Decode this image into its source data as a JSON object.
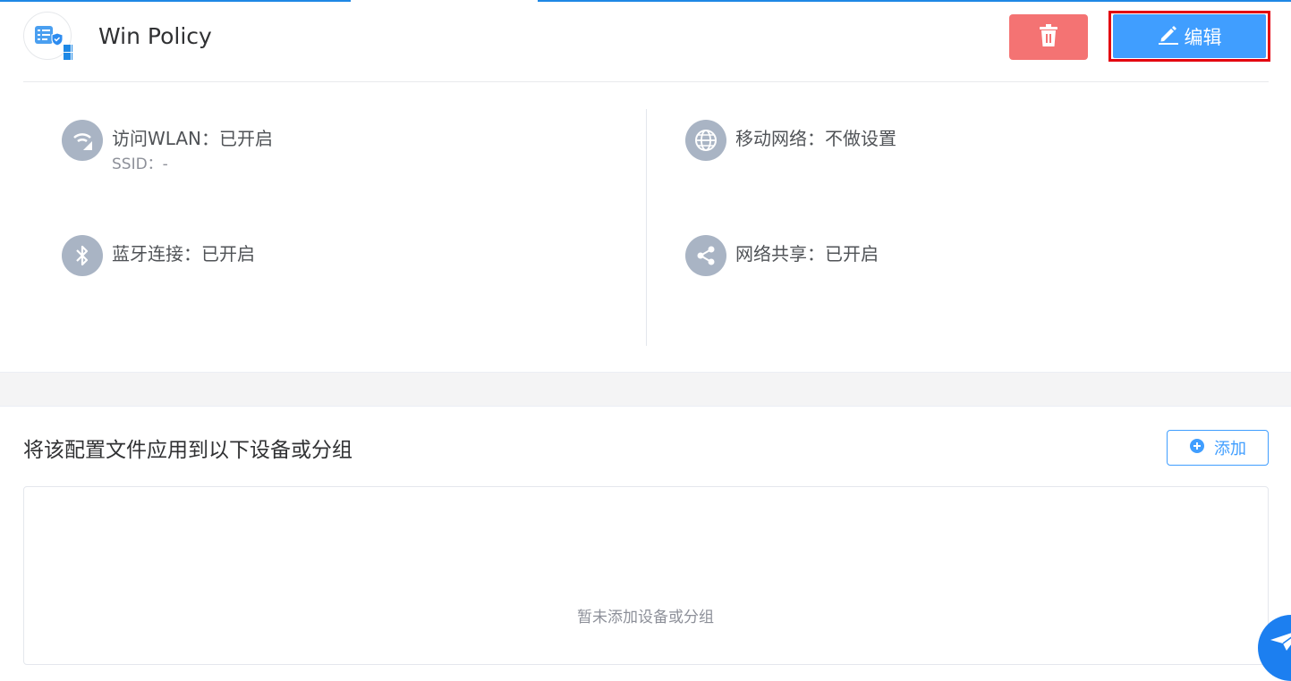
{
  "header": {
    "title": "Win Policy",
    "logo_icon": "policy-windows-icon",
    "delete_icon": "trash-icon",
    "edit_icon": "pencil-icon",
    "edit_label": "编辑"
  },
  "settings": {
    "wlan": {
      "icon": "wifi-icon",
      "label": "访问WLAN：已开启",
      "sub": "SSID：-"
    },
    "mobile": {
      "icon": "globe-icon",
      "label": "移动网络：不做设置"
    },
    "bluetooth": {
      "icon": "bluetooth-icon",
      "label": "蓝牙连接：已开启"
    },
    "sharing": {
      "icon": "share-icon",
      "label": "网络共享：已开启"
    }
  },
  "apply": {
    "title": "将该配置文件应用到以下设备或分组",
    "add_icon": "plus-circle-icon",
    "add_label": "添加",
    "empty_text": "暂未添加设备或分组"
  },
  "colors": {
    "primary": "#409eff",
    "danger": "#f47373",
    "highlight_outline": "#e3000f",
    "icon_bg": "#a9b4c4"
  }
}
